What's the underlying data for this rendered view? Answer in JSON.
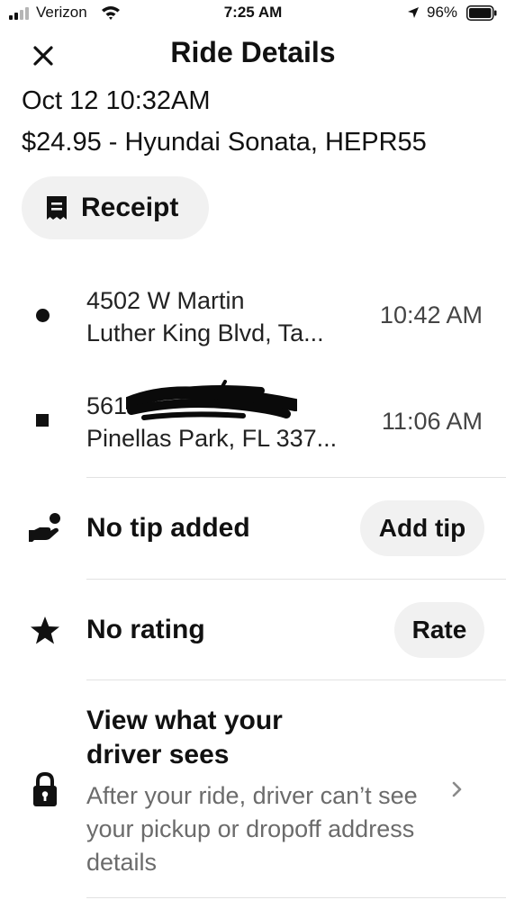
{
  "status_bar": {
    "carrier": "Verizon",
    "time": "7:25 AM",
    "battery": "96%"
  },
  "header": {
    "title": "Ride Details"
  },
  "trip": {
    "datetime": "Oct 12 10:32AM",
    "summary": "$24.95 - Hyundai Sonata, HEPR55"
  },
  "receipt_button": {
    "label": "Receipt"
  },
  "stops": [
    {
      "address_line1": "4502 W Martin",
      "address_line2": "Luther King Blvd, Ta...",
      "time": "10:42 AM"
    },
    {
      "address_line1": "561",
      "address_line2": "Pinellas Park, FL 337...",
      "time": "11:06 AM"
    }
  ],
  "tip": {
    "label": "No tip added",
    "button": "Add tip"
  },
  "rating": {
    "label": "No rating",
    "button": "Rate"
  },
  "driver_view": {
    "title": "View what your driver sees",
    "description": "After your ride, driver can’t see your pickup or dropoff address details"
  },
  "icons": {
    "close": "close-icon",
    "receipt": "receipt-icon",
    "tip": "tip-hand-icon",
    "star": "star-icon",
    "lock": "lock-icon",
    "chevron": "chevron-right-icon"
  }
}
